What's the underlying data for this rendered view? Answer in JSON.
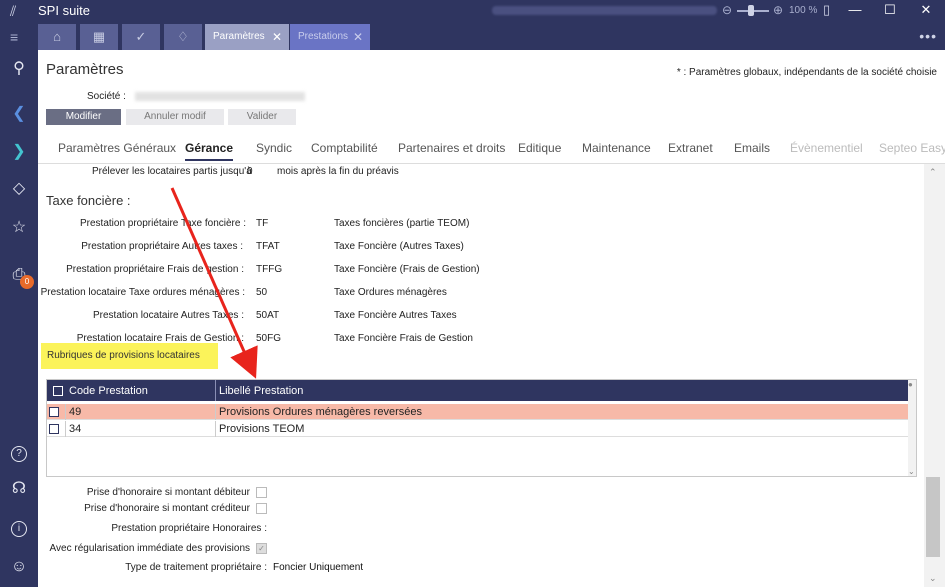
{
  "window": {
    "title": "SPI suite",
    "zoom_minus": "⊖",
    "zoom_plus": "⊕",
    "zoom": "100 %",
    "pdf_icon": "▯",
    "minimize": "—",
    "maximize": "☐",
    "close": "✕"
  },
  "tabs": {
    "nav_toggle": "≡",
    "icon_tabs": [
      {
        "icon": "home-icon",
        "glyph": "⌂"
      },
      {
        "icon": "calendar-icon",
        "glyph": "▦"
      },
      {
        "icon": "check-icon",
        "glyph": "✓"
      },
      {
        "icon": "bell-icon",
        "glyph": "🔔"
      }
    ],
    "documents": [
      {
        "label": "Paramètres",
        "close": "✕"
      },
      {
        "label": "Prestations",
        "close": "✕"
      }
    ],
    "more": "•••"
  },
  "sidebar": {
    "icons": [
      {
        "name": "search-icon",
        "glyph": "⚲"
      },
      {
        "name": "back-chevron-icon",
        "glyph": "❮"
      },
      {
        "name": "forward-chevron-icon",
        "glyph": "❯"
      },
      {
        "name": "diamond-icon",
        "glyph": "◇"
      },
      {
        "name": "star-icon",
        "glyph": "☆"
      },
      {
        "name": "printer-icon",
        "glyph": "⎙"
      },
      {
        "name": "help-icon",
        "glyph": "?"
      },
      {
        "name": "headset-icon",
        "glyph": "☊"
      },
      {
        "name": "info-icon",
        "glyph": "i"
      },
      {
        "name": "user-icon",
        "glyph": "☺"
      }
    ],
    "badge": "0"
  },
  "page": {
    "title": "Paramètres",
    "global_note": "* : Paramètres globaux, indépendants de la société choisie",
    "societe_label": "Société :",
    "societe_value": "",
    "buttons": {
      "modifier": "Modifier",
      "annuler": "Annuler modif",
      "valider": "Valider"
    }
  },
  "nav_tabs": [
    "Paramètres Généraux",
    "Gérance",
    "Syndic",
    "Comptabilité",
    "Partenaires et droits",
    "Editique",
    "Maintenance",
    "Extranet",
    "Emails",
    "Évènementiel",
    "Septeo Easy"
  ],
  "prelevement": {
    "label": "Prélever les locataires partis jusqu'à",
    "value": "0",
    "suffix": "mois après la fin du préavis"
  },
  "taxe_fonciere": {
    "title": "Taxe foncière :",
    "rows": [
      {
        "label": "Prestation propriétaire Taxe foncière :",
        "code": "TF",
        "desc": "Taxes foncières (partie TEOM)"
      },
      {
        "label": "Prestation propriétaire Autres taxes :",
        "code": "TFAT",
        "desc": "Taxe Foncière (Autres Taxes)"
      },
      {
        "label": "Prestation propriétaire Frais de gestion :",
        "code": "TFFG",
        "desc": "Taxe Foncière (Frais de Gestion)"
      },
      {
        "label": "Prestation locataire Taxe ordures ménagères :",
        "code": "50",
        "desc": "Taxe Ordures ménagères"
      },
      {
        "label": "Prestation locataire Autres Taxes :",
        "code": "50AT",
        "desc": "Taxe Foncière Autres Taxes"
      },
      {
        "label": "Prestation locataire Frais de Gestion :",
        "code": "50FG",
        "desc": "Taxe Foncière Frais de Gestion"
      }
    ]
  },
  "rubriques": {
    "title": "Rubriques de provisions locataires",
    "columns": [
      "Code Prestation",
      "Libellé Prestation"
    ],
    "rows": [
      {
        "code": "49",
        "libelle": "Provisions Ordures ménagères reversées"
      },
      {
        "code": "34",
        "libelle": "Provisions TEOM"
      }
    ]
  },
  "bottom": {
    "honoraire_debiteur": "Prise d'honoraire si montant débiteur",
    "honoraire_crediteur": "Prise d'honoraire si montant créditeur",
    "prestation_honoraires": "Prestation propriétaire Honoraires :",
    "regularisation": "Avec régularisation immédiate des provisions",
    "regularisation_check": "✓",
    "type_traitement_label": "Type de traitement propriétaire :",
    "type_traitement_value": "Foncier Uniquement"
  },
  "colors": {
    "nav_bg": "#2f3560",
    "selected_row": "#f7b9a8",
    "highlight": "#fbf35a",
    "annotation_arrow": "#e8241c"
  }
}
